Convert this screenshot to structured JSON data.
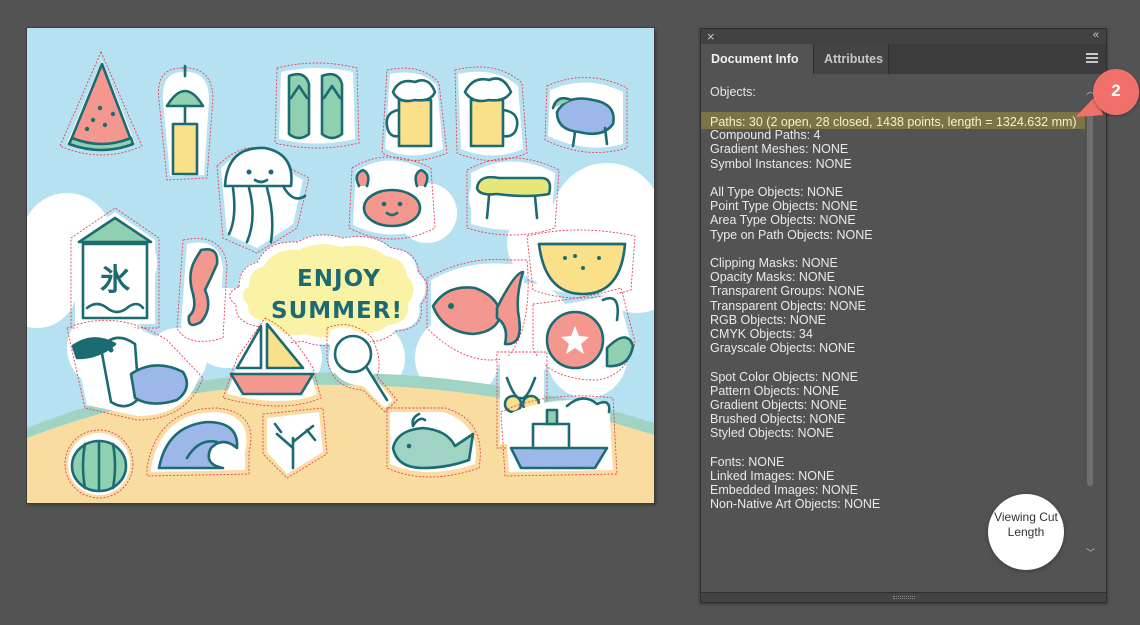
{
  "artboard": {
    "headline_line1": "ENJOY",
    "headline_line2": "SUMMER!",
    "sign_glyph": "氷",
    "colors": {
      "sky": "#b6e1f1",
      "sand": "#f9dda0",
      "sea": "#9fd4c5",
      "cloud": "#ffffff",
      "outline": "#1d6b72",
      "cut_line": "#e8405a",
      "bubble": "#faf3a6",
      "coral_pink": "#f4988f",
      "yellow": "#fbe08a",
      "green": "#8fd0b0",
      "blue": "#9bb8e8"
    },
    "stickers": [
      "watermelon-slice",
      "wind-chime",
      "flip-flops",
      "beer-mug",
      "beer-mug",
      "eggplant-cow",
      "jellyfish",
      "crab",
      "cucumber-horse",
      "shaved-ice-sign",
      "seahorse",
      "yellow-watermelon",
      "goldfish",
      "toucan",
      "sailboat",
      "magnifying-glass",
      "morning-glory",
      "bikini",
      "watermelon",
      "wave",
      "coral",
      "whale",
      "ship"
    ]
  },
  "panel": {
    "close_icon": "×",
    "collapse_icon": "«",
    "tabs": {
      "document_info": "Document Info",
      "attributes": "Attributes"
    },
    "objects_label": "Objects:",
    "lines": [
      "Paths: 30 (2 open, 28 closed, 1438 points, length = 1324.632 mm)",
      "Compound Paths: 4",
      "Gradient Meshes: NONE",
      "Symbol Instances: NONE",
      "",
      "All Type Objects: NONE",
      "Point Type Objects: NONE",
      "Area Type Objects: NONE",
      "Type on Path Objects: NONE",
      "",
      "Clipping Masks: NONE",
      "Opacity Masks: NONE",
      "Transparent Groups: NONE",
      "Transparent Objects: NONE",
      "RGB Objects: NONE",
      "CMYK Objects: 34",
      "Grayscale Objects: NONE",
      "",
      "Spot Color Objects: NONE",
      "Pattern Objects: NONE",
      "Gradient Objects: NONE",
      "Brushed Objects: NONE",
      "Styled Objects: NONE",
      "",
      "Fonts: NONE",
      "Linked Images: NONE",
      "Embedded Images: NONE",
      "Non-Native Art Objects: NONE"
    ],
    "highlight_color": "#7c7445"
  },
  "callouts": {
    "step_number": "2",
    "step_color": "#f0706a",
    "cut_length_label": "Viewing Cut Length"
  }
}
